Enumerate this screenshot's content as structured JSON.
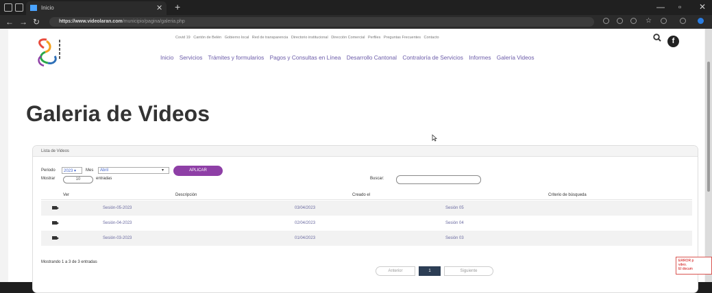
{
  "browser": {
    "tab_title": "Inicio",
    "url_host": "https://www.videolaran.com",
    "url_path": "/municipio/pagina/galeria.php"
  },
  "header": {
    "top_links": [
      "Covid 19",
      "Cantón de Belén",
      "Gobierno local",
      "Red de transparencia",
      "Directorio institucional",
      "Dirección Comercial",
      "Perfiles",
      "Preguntas Frecuentes",
      "Contacto"
    ],
    "main_nav": [
      "Inicio",
      "Servicios",
      "Trámites y formularios",
      "Pagos y Consultas en Línea",
      "Desarrollo Cantonal",
      "Contraloría de Servicios",
      "Informes",
      "Galería Videos"
    ]
  },
  "page": {
    "title": "Galeria de Videos"
  },
  "panel": {
    "header": "Lista de Videos",
    "periodo_label": "Periodo",
    "periodo_value": "2023",
    "mes_label": "Mes",
    "mes_value": "Abril",
    "apply_label": "APLICAR",
    "mostrar_label": "Mostrar",
    "mostrar_value": "10",
    "entradas_label": "entradas",
    "buscar_label": "Buscar:",
    "buscar_value": ""
  },
  "table": {
    "columns": [
      "Ver",
      "Descripción",
      "Creado el",
      "Criterio de búsqueda"
    ],
    "rows": [
      {
        "descripcion": "Sesión-05-2023",
        "creado": "03/04/2023",
        "criterio": "Sesión 05"
      },
      {
        "descripcion": "Sesión-04-2023",
        "creado": "02/04/2023",
        "criterio": "Sesión 04"
      },
      {
        "descripcion": "Sesión-03-2023",
        "creado": "01/04/2023",
        "criterio": "Sesión 03"
      }
    ],
    "info": "Mostrando 1 a 3 de 3 entradas"
  },
  "pagination": {
    "prev": "Anterior",
    "current": "1",
    "next": "Siguiente"
  },
  "error_box": {
    "line1": "ERROR p",
    "line2": "vdeo.",
    "line3": "El docum"
  },
  "colors": {
    "accent": "#8e3fa6",
    "nav_link": "#6a5aa8",
    "pagination_active": "#2c3e55"
  }
}
